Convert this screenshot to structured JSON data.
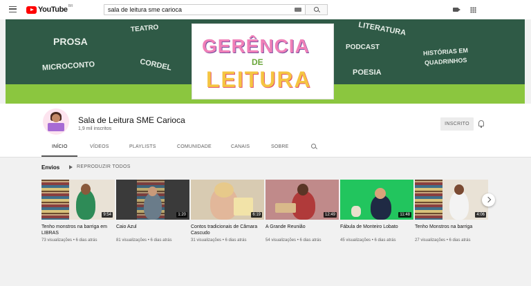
{
  "app": {
    "brand": "YouTube",
    "region": "BR"
  },
  "search": {
    "value": "sala de leitura sme carioca"
  },
  "banner": {
    "words": [
      "PROSA",
      "TEATRO",
      "LITERATURA",
      "PODCAST",
      "MICROCONTO",
      "CORDEL",
      "POESIA",
      "HISTÓRIAS EM",
      "QUADRINHOS"
    ],
    "logo_lines": [
      "GERÊNCIA",
      "DE",
      "LEITURA"
    ],
    "colors": {
      "dark_green": "#2f5a46",
      "light_green": "#8bc63f"
    }
  },
  "channel": {
    "name": "Sala de Leitura SME Carioca",
    "subscribers": "1,9 mil inscritos",
    "subscribe_label": "INSCRITO"
  },
  "tabs": [
    "INÍCIO",
    "VÍDEOS",
    "PLAYLISTS",
    "COMUNIDADE",
    "CANAIS",
    "SOBRE"
  ],
  "active_tab": "INÍCIO",
  "section": {
    "title": "Envios",
    "play_all": "REPRODUZIR TODOS"
  },
  "videos": [
    {
      "title": "Tenho monstros na barriga em LIBRAS",
      "duration": "9:54",
      "meta": "73 visualizações • 6 dias atrás"
    },
    {
      "title": "Caio Azul",
      "duration": "1:20",
      "meta": "81 visualizações • 6 dias atrás"
    },
    {
      "title": "Contos tradicionais de Câmara Cascudo",
      "duration": "6:19",
      "meta": "31 visualizações • 6 dias atrás"
    },
    {
      "title": "A Grande Reunião",
      "duration": "12:49",
      "meta": "54 visualizações • 6 dias atrás"
    },
    {
      "title": "Fábula de Monteiro Lobato",
      "duration": "11:48",
      "meta": "45 visualizações • 6 dias atrás"
    },
    {
      "title": "Tenho Monstros na barriga",
      "duration": "4:06",
      "meta": "27 visualizações • 6 dias atrás"
    }
  ]
}
